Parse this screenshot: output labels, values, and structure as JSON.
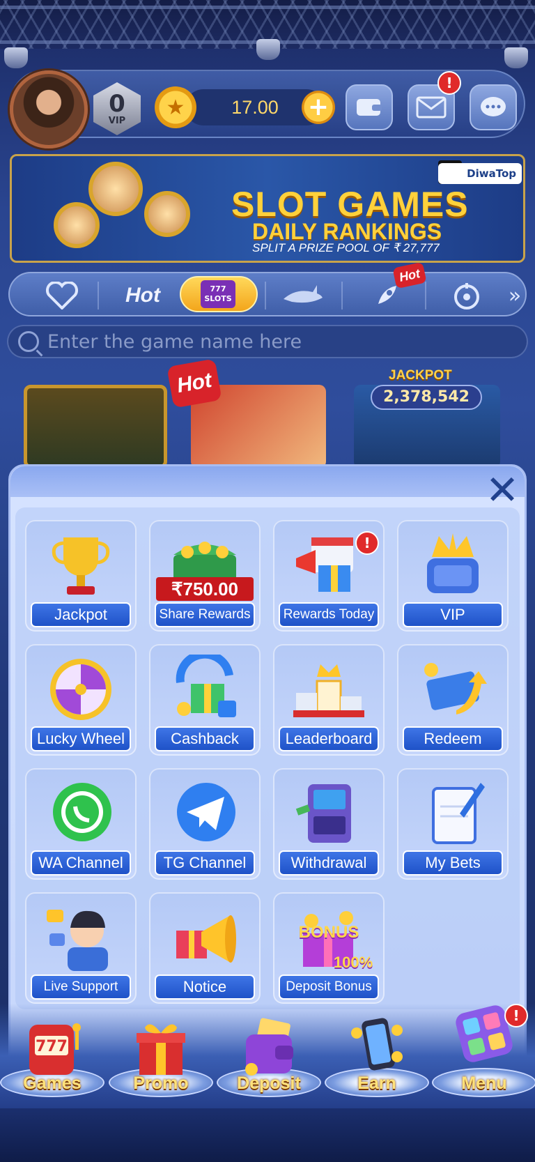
{
  "header": {
    "vip_level": "0",
    "vip_label": "VIP",
    "balance": "17.00",
    "plus_symbol": "+",
    "mail_alert": "!"
  },
  "banner": {
    "title": "SLOT GAMES",
    "subtitle": "DAILY RANKINGS",
    "prize_text": "SPLIT A PRIZE POOL OF ₹ 27,777",
    "brand": "DiwaTop"
  },
  "categories": {
    "items": [
      {
        "icon": "heart-icon"
      },
      {
        "label": "Hot"
      },
      {
        "label": "SLOTS",
        "active": true
      },
      {
        "icon": "shark-icon"
      },
      {
        "icon": "rocket-icon",
        "badge": "Hot"
      },
      {
        "icon": "roulette-icon"
      }
    ]
  },
  "search": {
    "placeholder": "Enter the game name here"
  },
  "games": {
    "hot_tag": "Hot",
    "jackpot_label": "JACKPOT",
    "jackpot_value": "2,378,542"
  },
  "menu": {
    "close_symbol": "✕",
    "alert": "!",
    "share_amount": "₹750.00",
    "tiles": [
      {
        "label": "Jackpot",
        "icon": "trophy-icon"
      },
      {
        "label": "Share Rewards",
        "icon": "treasure-chest-icon"
      },
      {
        "label": "Rewards Today",
        "icon": "megaphone-gift-icon"
      },
      {
        "label": "VIP",
        "icon": "crown-throne-icon"
      },
      {
        "label": "Lucky Wheel",
        "icon": "wheel-icon"
      },
      {
        "label": "Cashback",
        "icon": "cashback-gift-icon"
      },
      {
        "label": "Leaderboard",
        "icon": "podium-icon"
      },
      {
        "label": "Redeem",
        "icon": "ticket-icon"
      },
      {
        "label": "WA Channel",
        "icon": "whatsapp-icon"
      },
      {
        "label": "TG Channel",
        "icon": "telegram-icon"
      },
      {
        "label": "Withdrawal",
        "icon": "atm-icon"
      },
      {
        "label": "My Bets",
        "icon": "notebook-icon"
      },
      {
        "label": "Live Support",
        "icon": "support-agent-icon"
      },
      {
        "label": "Notice",
        "icon": "notice-megaphone-icon"
      },
      {
        "label": "Deposit Bonus",
        "icon": "bonus-gift-icon"
      }
    ],
    "bonus_text": "BONUS",
    "bonus_pct": "100%"
  },
  "bottom_nav": {
    "items": [
      {
        "label": "Games",
        "icon": "slot-machine-icon"
      },
      {
        "label": "Promo",
        "icon": "gift-box-icon"
      },
      {
        "label": "Deposit",
        "icon": "wallet-icon"
      },
      {
        "label": "Earn",
        "icon": "phone-coins-icon"
      },
      {
        "label": "Menu",
        "icon": "menu-cube-icon"
      }
    ],
    "menu_alert": "!"
  }
}
